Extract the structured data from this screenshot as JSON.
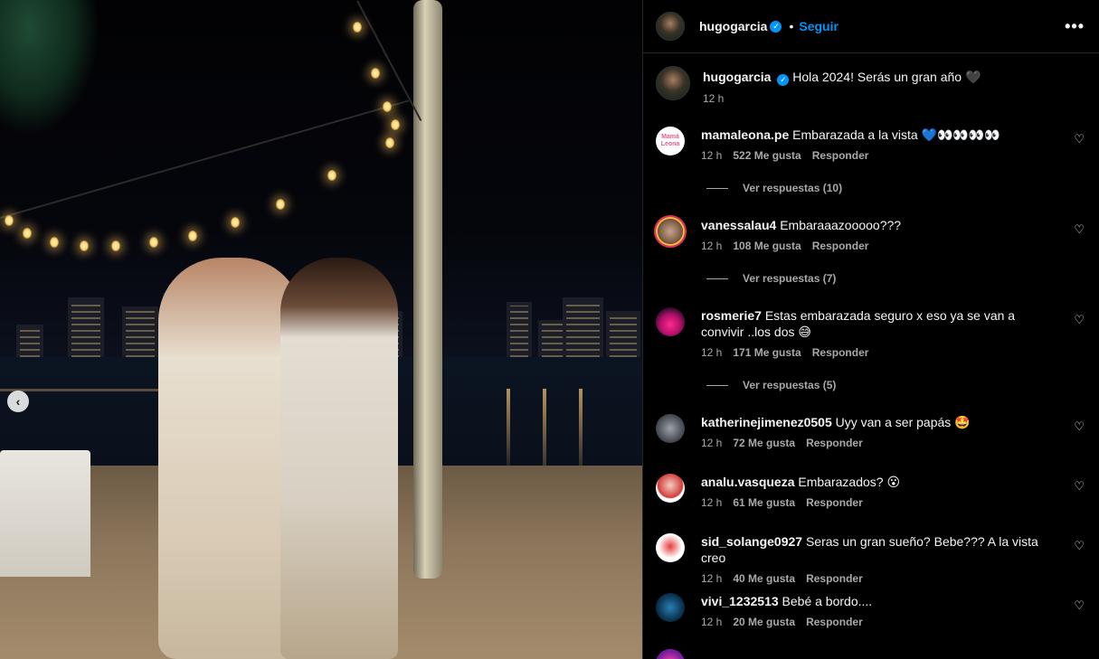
{
  "post": {
    "username": "hugogarcia",
    "follow_label": "Seguir",
    "more_label": "•••",
    "caption_text": "Hola 2024! Serás un gran año 🖤",
    "caption_time": "12 h",
    "carousel_prev": "‹"
  },
  "comments": [
    {
      "user": "mamaleona.pe",
      "avatar_text": "Mamá Leona",
      "text": "Embarazada a la vista 💙👀👀👀👀",
      "time": "12 h",
      "likes": "522 Me gusta",
      "reply": "Responder",
      "replies_label": "Ver respuestas (10)"
    },
    {
      "user": "vanessalau4",
      "text": "Embaraaazooooo???",
      "time": "12 h",
      "likes": "108 Me gusta",
      "reply": "Responder",
      "replies_label": "Ver respuestas (7)"
    },
    {
      "user": "rosmerie7",
      "text": "Estas embarazada seguro x eso ya se van a convivir ..los dos 😅",
      "time": "12 h",
      "likes": "171 Me gusta",
      "reply": "Responder",
      "replies_label": "Ver respuestas (5)"
    },
    {
      "user": "katherinejimenez0505",
      "text": "Uyy van a ser papás 🤩",
      "time": "12 h",
      "likes": "72 Me gusta",
      "reply": "Responder"
    },
    {
      "user": "analu.vasqueza",
      "text": "Embarazados? 😮",
      "time": "12 h",
      "likes": "61 Me gusta",
      "reply": "Responder"
    },
    {
      "user": "sid_solange0927",
      "text": "Seras un gran sueño? Bebe??? A la vista creo",
      "time": "12 h",
      "likes": "40 Me gusta",
      "reply": "Responder"
    },
    {
      "user": "vivi_1232513",
      "text": "Bebé a bordo....",
      "time": "12 h",
      "likes": "20 Me gusta",
      "reply": "Responder"
    }
  ],
  "icons": {
    "verified": "✓",
    "heart": "♡"
  },
  "colors": {
    "accent_blue": "#0095f6",
    "panel_bg": "#000000",
    "muted_text": "#a8a8a8"
  }
}
